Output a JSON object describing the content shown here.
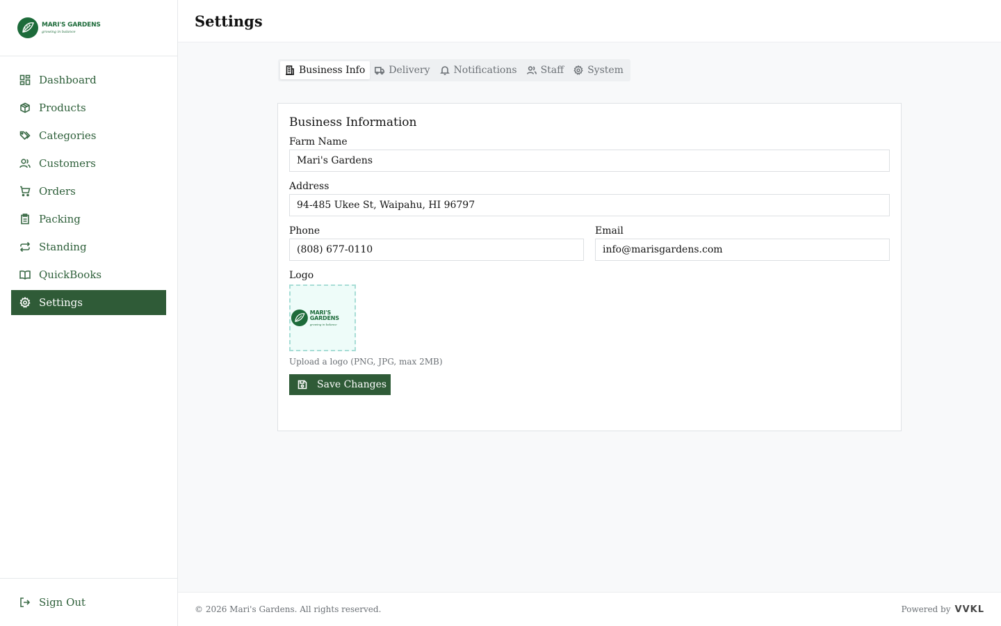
{
  "brand": {
    "name": "MARI'S GARDENS",
    "tagline": "growing in balance",
    "color": "#1d6b3a"
  },
  "sidebar": {
    "items": [
      {
        "label": "Dashboard",
        "icon": "dashboard-icon"
      },
      {
        "label": "Products",
        "icon": "box-icon"
      },
      {
        "label": "Categories",
        "icon": "tags-icon"
      },
      {
        "label": "Customers",
        "icon": "users-icon"
      },
      {
        "label": "Orders",
        "icon": "cart-icon"
      },
      {
        "label": "Packing",
        "icon": "clipboard-icon"
      },
      {
        "label": "Standing",
        "icon": "repeat-icon"
      },
      {
        "label": "QuickBooks",
        "icon": "book-icon"
      },
      {
        "label": "Settings",
        "icon": "gear-icon",
        "active": true
      }
    ],
    "signout_label": "Sign Out",
    "active_color": "#2f5b37"
  },
  "header": {
    "title": "Settings"
  },
  "tabs": [
    {
      "label": "Business Info",
      "icon": "building-icon",
      "active": true
    },
    {
      "label": "Delivery",
      "icon": "truck-icon"
    },
    {
      "label": "Notifications",
      "icon": "bell-icon"
    },
    {
      "label": "Staff",
      "icon": "users-icon"
    },
    {
      "label": "System",
      "icon": "gear-icon"
    }
  ],
  "form": {
    "title": "Business Information",
    "farm_name_label": "Farm Name",
    "farm_name_value": "Mari's Gardens",
    "address_label": "Address",
    "address_value": "94-485 Ukee St, Waipahu, HI 96797",
    "phone_label": "Phone",
    "phone_value": "(808) 677-0110",
    "email_label": "Email",
    "email_value": "info@marisgardens.com",
    "logo_label": "Logo",
    "logo_hint": "Upload a logo (PNG, JPG, max 2MB)",
    "save_label": "Save Changes"
  },
  "footer": {
    "copyright": "© 2026 Mari's Gardens. All rights reserved.",
    "powered_by": "Powered by",
    "powered_brand": "VVKL"
  }
}
